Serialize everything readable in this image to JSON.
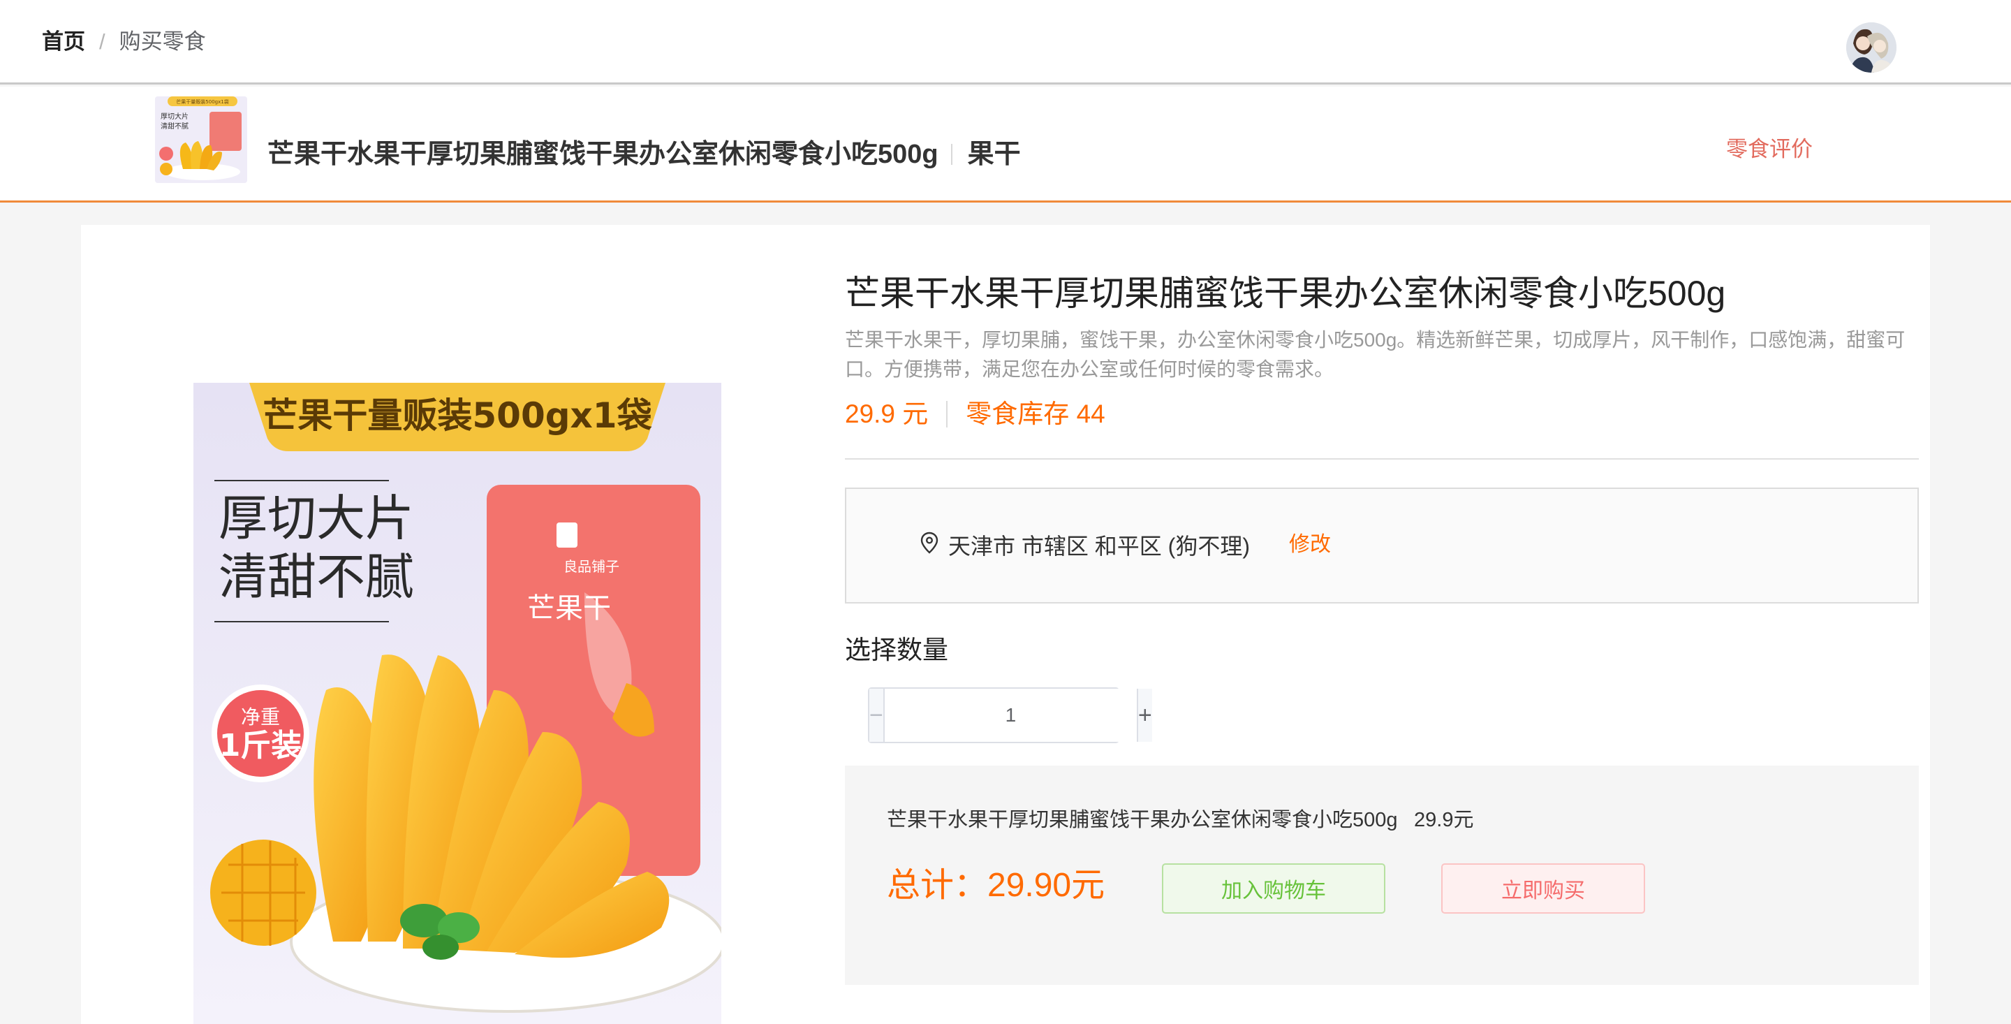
{
  "breadcrumb": {
    "home": "首页",
    "separator": "/",
    "current": "购买零食"
  },
  "user": {
    "avatar_icon": "user-avatar-icon"
  },
  "product_bar": {
    "name": "芒果干水果干厚切果脯蜜饯干果办公室休闲零食小吃500g",
    "category": "果干",
    "review_link": "零食评价"
  },
  "product": {
    "title": "芒果干水果干厚切果脯蜜饯干果办公室休闲零食小吃500g",
    "description": "芒果干水果干，厚切果脯，蜜饯干果，办公室休闲零食小吃500g。精选新鲜芒果，切成厚片，风干制作，口感饱满，甜蜜可口。方便携带，满足您在办公室或任何时候的零食需求。",
    "price": "29.9 元",
    "stock": "零食库存 44",
    "image": {
      "banner": "芒果干量贩装500gx1袋",
      "slogan_line1": "厚切大片",
      "slogan_line2": "清甜不腻",
      "badge_line1": "净重",
      "badge_line2": "1斤装",
      "brand": "良品铺子",
      "package_text": "芒果干"
    },
    "thumb": {
      "banner": "芒果干量贩装500gx1袋",
      "slogan_line1": "厚切大片",
      "slogan_line2": "清甜不腻"
    }
  },
  "address": {
    "icon": "location-pin-icon",
    "text": "天津市 市辖区 和平区 (狗不理)",
    "edit_label": "修改"
  },
  "quantity": {
    "label": "选择数量",
    "value": "1",
    "minus": "−",
    "plus": "+"
  },
  "summary": {
    "item_name": "芒果干水果干厚切果脯蜜饯干果办公室休闲零食小吃500g",
    "item_price": "29.9元",
    "total": "总计：29.90元",
    "add_to_cart": "加入购物车",
    "buy_now": "立即购买"
  },
  "colors": {
    "accent_orange": "#ff6a00",
    "review_red": "#e26b5e",
    "cart_green": "#67c23a",
    "buy_red": "#f56c6c",
    "header_underline": "#f08a3a"
  }
}
